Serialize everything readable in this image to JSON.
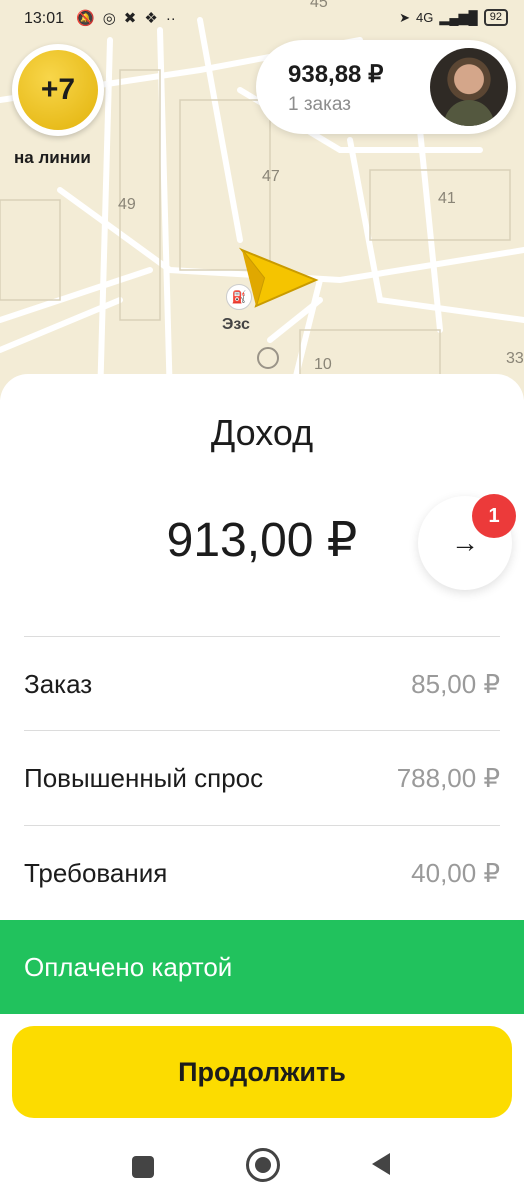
{
  "status_bar": {
    "time": "13:01",
    "network": "4G",
    "battery": "92"
  },
  "map": {
    "labels": [
      "45",
      "47",
      "49",
      "41",
      "10",
      "33"
    ],
    "station_label": "Эзс"
  },
  "rank": {
    "value": "+7",
    "label": "на линии"
  },
  "balance": {
    "amount": "938,88 ₽",
    "orders": "1 заказ"
  },
  "sheet": {
    "title": "Доход",
    "total": "913,00 ₽",
    "notifications_count": "1",
    "rows": [
      {
        "label": "Заказ",
        "value": "85,00 ₽"
      },
      {
        "label": "Повышенный спрос",
        "value": "788,00 ₽"
      },
      {
        "label": "Требования",
        "value": "40,00 ₽"
      }
    ],
    "payment_status": "Оплачено картой",
    "continue_label": "Продолжить"
  },
  "colors": {
    "accent_yellow": "#fcdc00",
    "paid_green": "#21c25d",
    "badge_red": "#ec3a3a"
  },
  "icons": {
    "details": "arrow-right-icon",
    "nav": [
      "square-icon",
      "home-circle-icon",
      "back-triangle-icon"
    ]
  }
}
